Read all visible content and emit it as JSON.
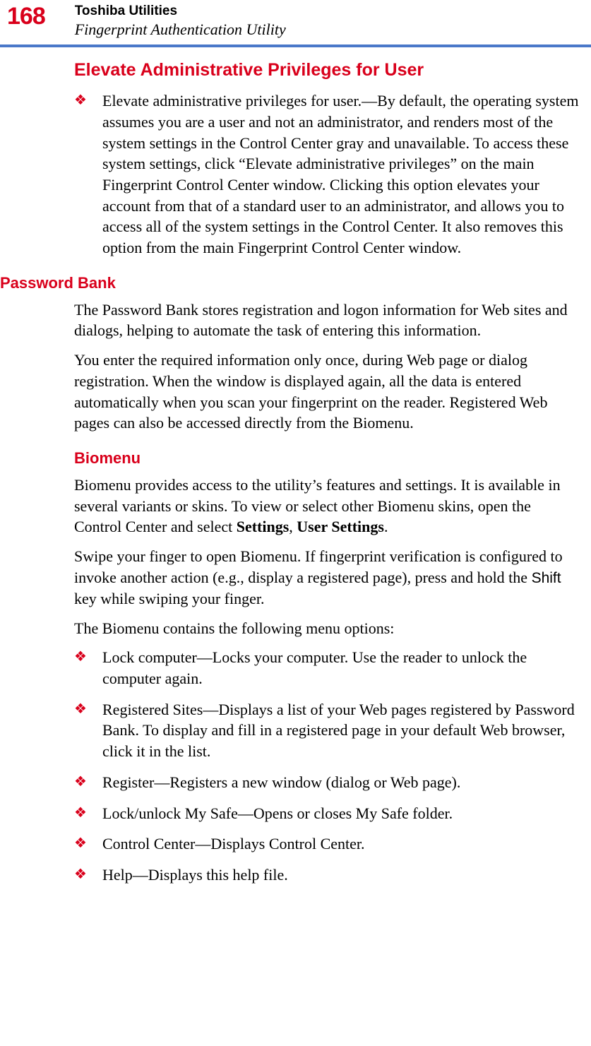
{
  "page_number": "168",
  "header": {
    "chapter": "Toshiba Utilities",
    "section": "Fingerprint Authentication Utility"
  },
  "elevate": {
    "heading": "Elevate Administrative Privileges for User",
    "bullet": "Elevate administrative privileges for user.—By default, the operating system assumes you are a user and not an administrator, and renders most of the system settings in the Control Center gray and unavailable. To access these system settings, click “Elevate administrative privileges” on the main Fingerprint Control Center window. Clicking this option elevates your account from that of a standard user to an administrator, and allows you to access all of the system settings in the Control Center. It also removes this option from the main Fingerprint Control Center window."
  },
  "password_bank": {
    "heading": "Password Bank",
    "p1": "The Password Bank stores registration and logon information for Web sites and dialogs, helping to automate the task of entering this information.",
    "p2": "You enter the required information only once, during Web page or dialog registration. When the window is displayed again, all the data is entered automatically when you scan your fingerprint on the reader. Registered Web pages can also be accessed directly from the Biomenu."
  },
  "biomenu": {
    "heading": "Biomenu",
    "p1_prefix": "Biomenu provides access to the utility’s features and settings. It is available in several variants or skins. To view or select other Biomenu skins, open the Control Center and select ",
    "p1_bold1": "Settings",
    "p1_sep": ", ",
    "p1_bold2": "User Settings",
    "p1_suffix": ".",
    "p2_prefix": "Swipe your finger to open Biomenu. If fingerprint verification is configured to invoke another action (e.g., display a registered page), press and hold the ",
    "p2_key": "Shift",
    "p2_suffix": " key while swiping your finger.",
    "p3": "The Biomenu contains the following menu options:",
    "bullets": [
      "Lock computer—Locks your computer. Use the reader to unlock the computer again.",
      "Registered Sites—Displays a list of your Web pages registered by Password Bank. To display and fill in a registered page in your default Web browser, click it in the list.",
      "Register—Registers a new window (dialog or Web page).",
      "Lock/unlock My Safe—Opens or closes My Safe folder.",
      "Control Center—Displays Control Center.",
      "Help—Displays this help file."
    ]
  }
}
